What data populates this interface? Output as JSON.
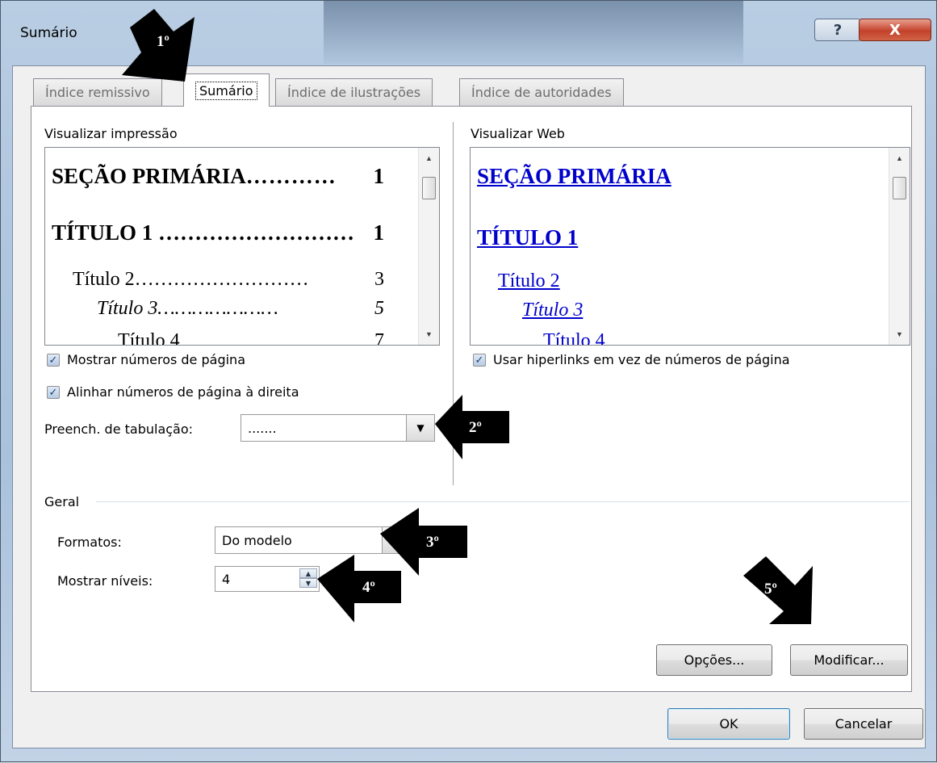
{
  "window": {
    "title": "Sumário",
    "help_glyph": "?",
    "close_glyph": "X"
  },
  "tabs": [
    {
      "label": "Índice remissivo",
      "active": false
    },
    {
      "label": "Sumário",
      "active": true
    },
    {
      "label": "Índice de ilustrações",
      "active": false
    },
    {
      "label": "Índice de autoridades",
      "active": false
    }
  ],
  "print_preview": {
    "label": "Visualizar impressão",
    "lines": [
      {
        "text": "SEÇÃO PRIMÁRIA",
        "page": "1"
      },
      {
        "text": "TÍTULO 1",
        "page": "1"
      },
      {
        "text": "Título 2",
        "page": "3"
      },
      {
        "text": "Título 3",
        "page": "5"
      },
      {
        "text": "Título 4",
        "page": "7"
      }
    ]
  },
  "web_preview": {
    "label": "Visualizar Web",
    "lines": [
      "SEÇÃO PRIMÁRIA",
      "TÍTULO 1",
      "Título 2",
      "Título 3",
      "Título 4"
    ]
  },
  "options": {
    "show_page_numbers": "Mostrar números de página",
    "align_right": "Alinhar números de página à direita",
    "use_hyperlinks": "Usar hiperlinks em vez de números de página",
    "tab_leader_label": "Preench. de tabulação:",
    "tab_leader_value": "......."
  },
  "general": {
    "legend": "Geral",
    "formats_label": "Formatos:",
    "formats_value": "Do modelo",
    "levels_label": "Mostrar níveis:",
    "levels_value": "4"
  },
  "buttons": {
    "options": "Opções...",
    "modify": "Modificar...",
    "ok": "OK",
    "cancel": "Cancelar"
  },
  "annotations": [
    "1º",
    "2º",
    "3º",
    "4º",
    "5º"
  ],
  "icons": {
    "checkbox": "check-icon",
    "dropdown": "chevron-down-icon",
    "spin": "spin-updown-icon"
  }
}
